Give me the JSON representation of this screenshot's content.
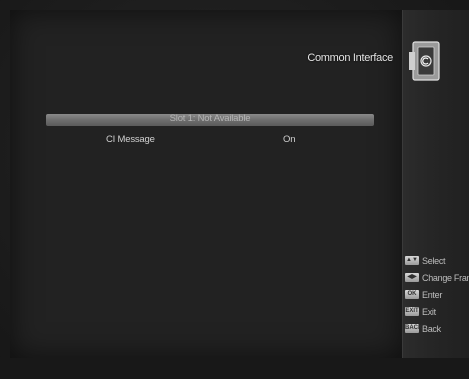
{
  "header": {
    "title": "Common Interface",
    "icon": "common-interface-module-icon"
  },
  "menu": {
    "slot_status": "Slot 1: Not Available",
    "ci_message_label": "CI Message",
    "ci_message_value": "On"
  },
  "help": {
    "items": [
      {
        "key": "select-key-icon",
        "key_glyph": "▲▼",
        "label": "Select"
      },
      {
        "key": "change-frame-key-icon",
        "key_glyph": "◀▶",
        "label": "Change Fram"
      },
      {
        "key": "ok-key-icon",
        "key_glyph": "OK",
        "label": "Enter"
      },
      {
        "key": "exit-key-icon",
        "key_glyph": "EXIT",
        "label": "Exit"
      },
      {
        "key": "back-key-icon",
        "key_glyph": "BACK",
        "label": "Back"
      }
    ]
  },
  "colors": {
    "background": "#222222",
    "highlight_bar": "#7a7a7a",
    "text": "#d0d0d0"
  }
}
